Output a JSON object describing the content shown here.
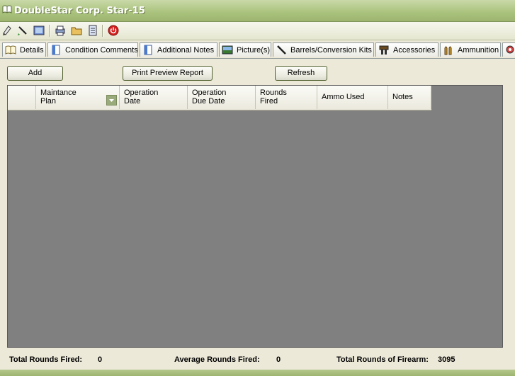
{
  "window": {
    "title": "DoubleStar Corp. Star-15"
  },
  "toolbar": {
    "icons": [
      "new-record-icon",
      "edit-icon",
      "picture-icon",
      "printer-icon",
      "folder-icon",
      "report-icon",
      "power-icon"
    ]
  },
  "tabs": [
    {
      "label": "Details",
      "icon": "book-icon"
    },
    {
      "label": "Condition Comments",
      "icon": "document-icon"
    },
    {
      "label": "Additional Notes",
      "icon": "document-icon"
    },
    {
      "label": "Picture(s)",
      "icon": "picture-icon"
    },
    {
      "label": "Barrels/Conversion Kits",
      "icon": "barrel-icon"
    },
    {
      "label": "Accessories",
      "icon": "accessories-icon"
    },
    {
      "label": "Ammunition",
      "icon": "ammo-icon"
    }
  ],
  "buttons": {
    "add": "Add",
    "print_preview": "Print Preview Report",
    "refresh": "Refresh"
  },
  "grid": {
    "columns": [
      "Maintance\nPlan",
      "Operation\nDate",
      "Operation\nDue Date",
      "Rounds\nFired",
      "Ammo Used",
      "Notes"
    ],
    "rows": []
  },
  "status": {
    "total_rounds_label": "Total Rounds Fired:",
    "total_rounds_value": "0",
    "avg_rounds_label": "Average Rounds Fired:",
    "avg_rounds_value": "0",
    "total_firearm_label": "Total Rounds of Firearm:",
    "total_firearm_value": "3095"
  },
  "colors": {
    "title_bar": "#a9c27c",
    "grid_bg": "#808080",
    "stop_icon": "#d42020"
  }
}
